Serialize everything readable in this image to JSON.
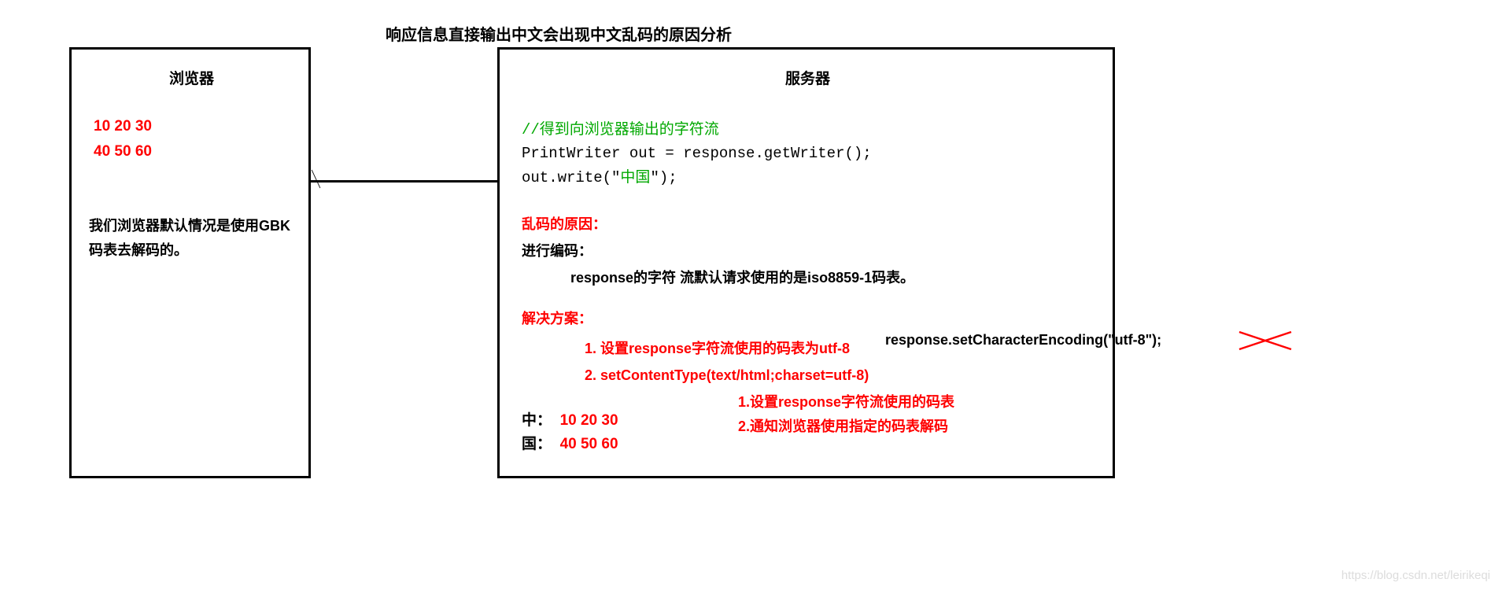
{
  "title": "响应信息直接输出中文会出现中文乱码的原因分析",
  "browser": {
    "heading": "浏览器",
    "numRow1": "10 20 30",
    "numRow2": "40 50 60",
    "note": "我们浏览器默认情况是使用GBK码表去解码的。"
  },
  "server": {
    "heading": "服务器",
    "comment": "//得到向浏览器输出的字符流",
    "code1": "PrintWriter out = response.getWriter();",
    "code2_prefix": "out.write(\"",
    "code2_cn": "中国",
    "code2_suffix": "\");",
    "reasonLabel": "乱码的原因：",
    "encodeLabel": "进行编码：",
    "encodeDetail_a": "response的字符",
    "encodeDetail_b": "流默认请求使用的是iso8859-1码表。",
    "solutionLabel": "解决方案：",
    "solution1": "1. 设置response字符流使用的码表为utf-8",
    "solution2": "2. setContentType(text/html;charset=utf-8)",
    "byteRow1_ch": "中：  ",
    "byteRow1_num": "10 20 30",
    "byteRow2_ch": "国：  ",
    "byteRow2_num": "40 50 60"
  },
  "overflowCode": "response.setCharacterEncoding(\"utf-8\");",
  "subnotes": {
    "line1": "1.设置response字符流使用的码表",
    "line2": "2.通知浏览器使用指定的码表解码"
  },
  "watermark": "https://blog.csdn.net/leirikeqi"
}
